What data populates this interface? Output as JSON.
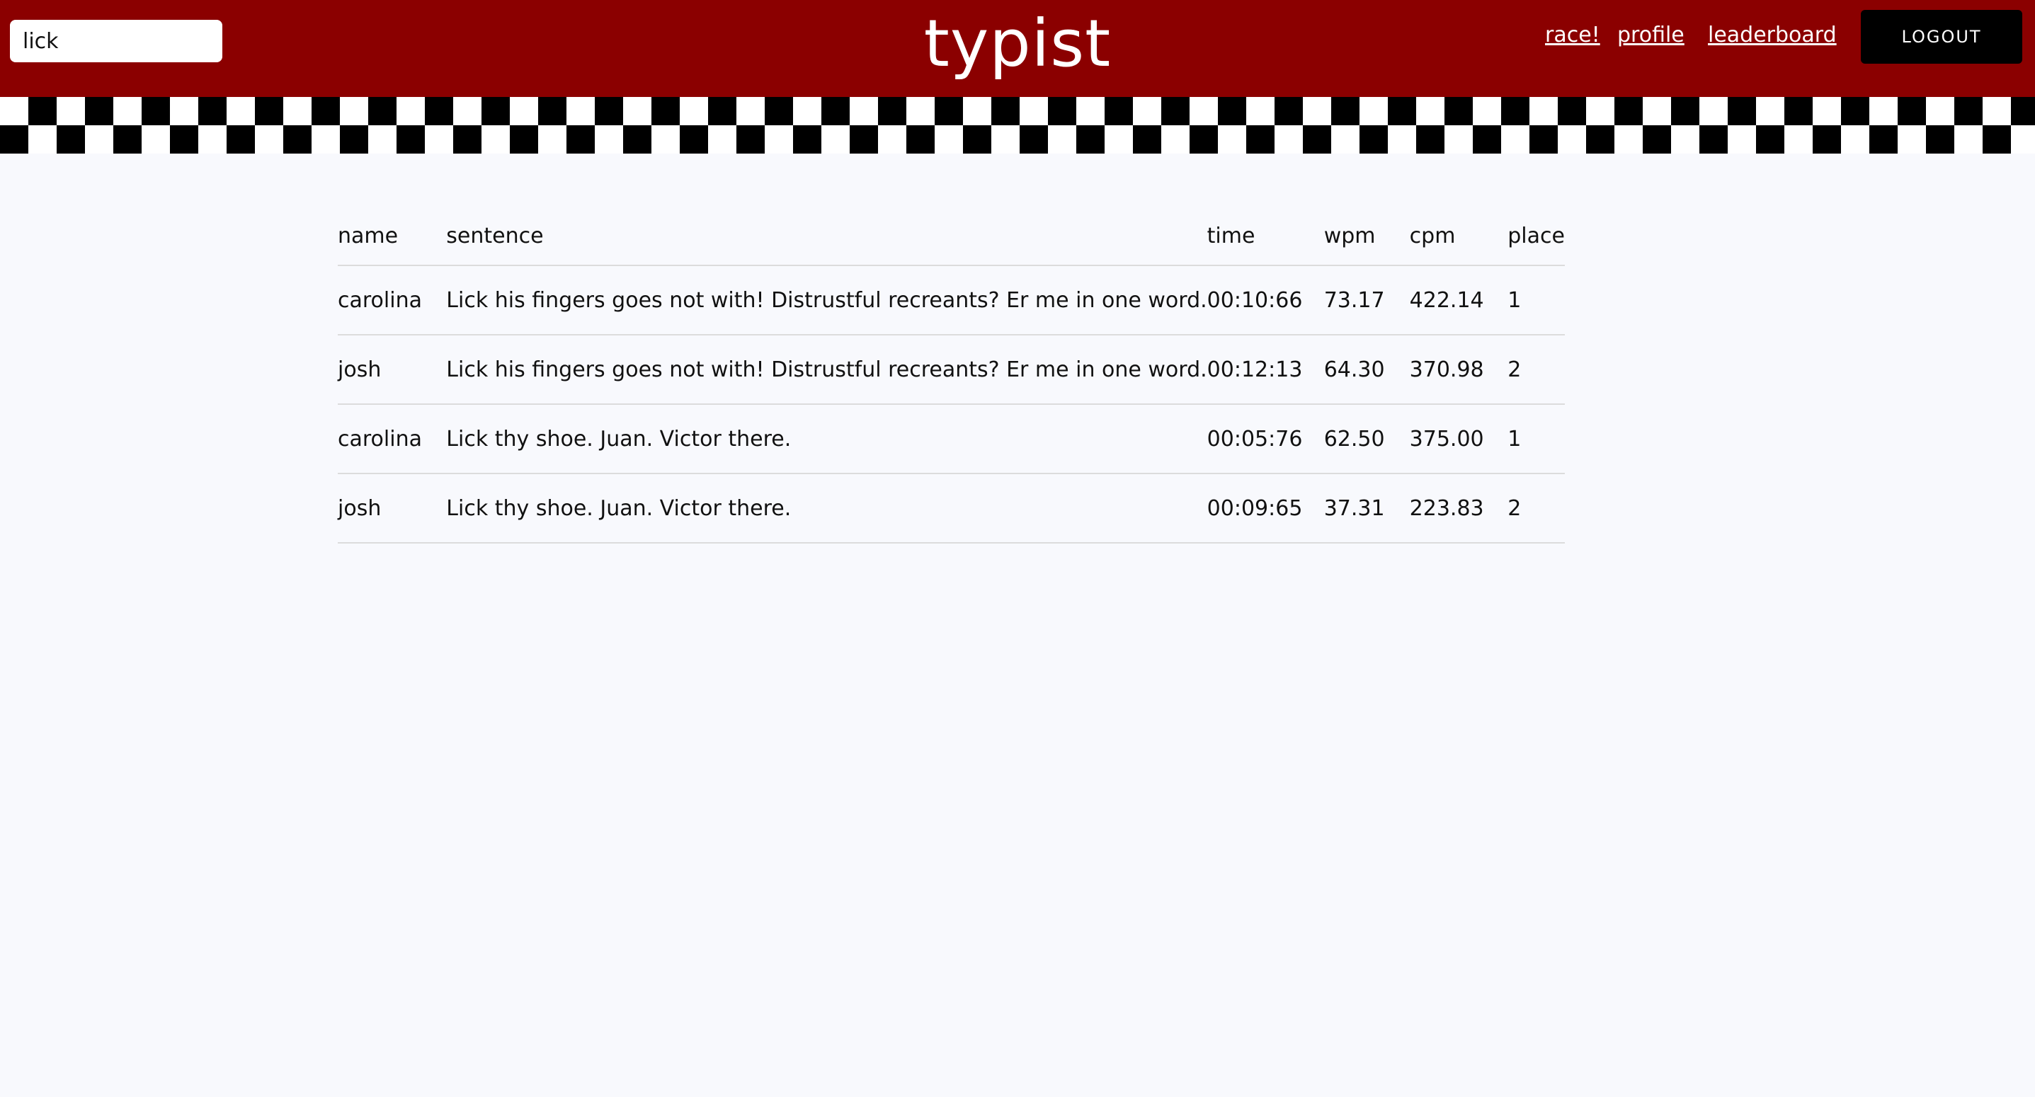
{
  "header": {
    "search_value": "lick",
    "logo": "typist",
    "nav": {
      "race": "race!",
      "profile": "profile",
      "leaderboard": "leaderboard"
    },
    "logout_label": "LOGOUT"
  },
  "colors": {
    "header_bg": "#8b0000",
    "page_bg": "#f8f9fd",
    "button_bg": "#000000"
  },
  "table": {
    "columns": [
      "name",
      "sentence",
      "time",
      "wpm",
      "cpm",
      "place"
    ],
    "rows": [
      {
        "name": "carolina",
        "sentence": "Lick his fingers goes not with! Distrustful recreants? Er me in one word.",
        "time": "00:10:66",
        "wpm": "73.17",
        "cpm": "422.14",
        "place": "1"
      },
      {
        "name": "josh",
        "sentence": "Lick his fingers goes not with! Distrustful recreants? Er me in one word.",
        "time": "00:12:13",
        "wpm": "64.30",
        "cpm": "370.98",
        "place": "2"
      },
      {
        "name": "carolina",
        "sentence": "Lick thy shoe. Juan. Victor there.",
        "time": "00:05:76",
        "wpm": "62.50",
        "cpm": "375.00",
        "place": "1"
      },
      {
        "name": "josh",
        "sentence": "Lick thy shoe. Juan. Victor there.",
        "time": "00:09:65",
        "wpm": "37.31",
        "cpm": "223.83",
        "place": "2"
      }
    ]
  }
}
